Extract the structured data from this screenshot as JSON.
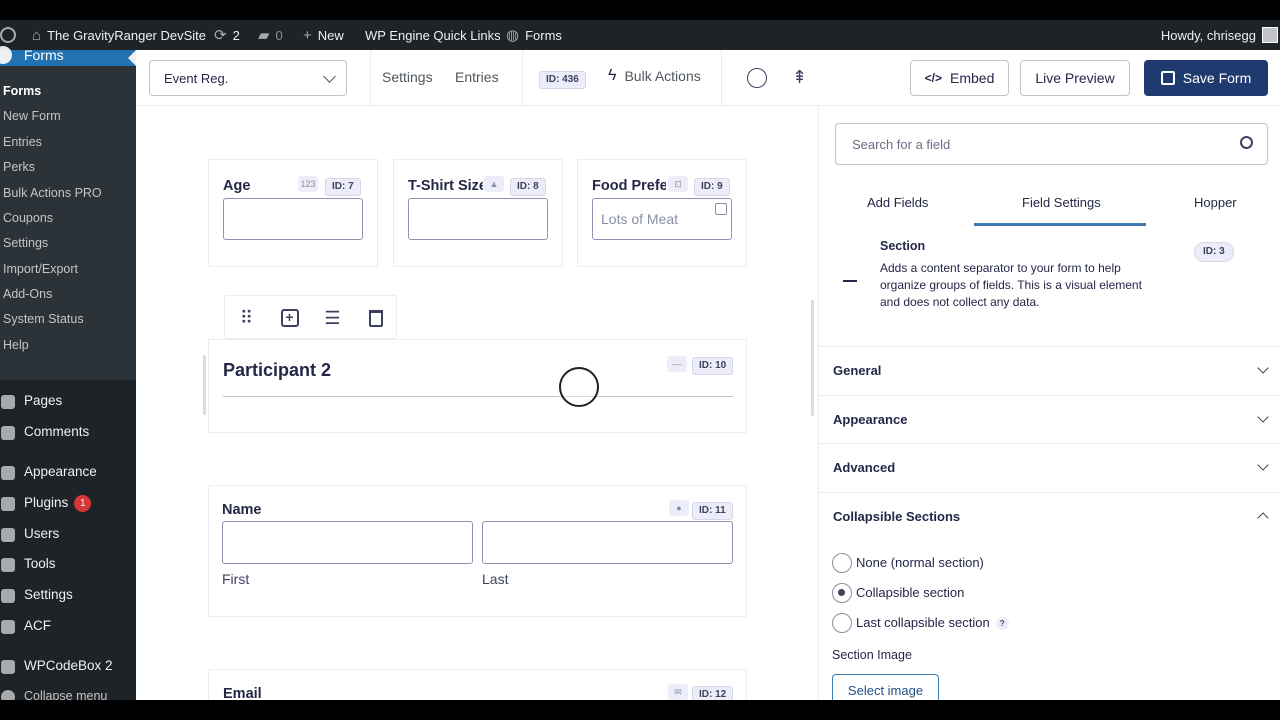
{
  "admin_bar": {
    "site_name": "The GravityRanger DevSite",
    "updates_count": "2",
    "comments_count": "0",
    "new_label": "New",
    "wp_engine": "WP Engine Quick Links",
    "forms": "Forms",
    "howdy": "Howdy, chrisegg"
  },
  "sidebar": {
    "current": "Forms",
    "submenu": [
      "Forms",
      "New Form",
      "Entries",
      "Perks",
      "Bulk Actions PRO",
      "Coupons",
      "Settings",
      "Import/Export",
      "Add-Ons",
      "System Status",
      "Help"
    ],
    "menu": [
      {
        "label": "Pages"
      },
      {
        "label": "Comments"
      },
      {
        "label": "Appearance"
      },
      {
        "label": "Plugins",
        "badge": "1"
      },
      {
        "label": "Users"
      },
      {
        "label": "Tools"
      },
      {
        "label": "Settings"
      },
      {
        "label": "ACF"
      },
      {
        "label": "WPCodeBox 2"
      },
      {
        "label": "Collapse menu"
      }
    ]
  },
  "toolbar": {
    "form_select": "Event Reg.",
    "settings": "Settings",
    "entries": "Entries",
    "form_id": "ID: 436",
    "bulk_actions": "Bulk Actions",
    "embed": "Embed",
    "live_preview": "Live Preview",
    "save_form": "Save Form"
  },
  "canvas": {
    "age": {
      "label": "Age",
      "id": "ID: 7",
      "icon": "123"
    },
    "tshirt": {
      "label": "T-Shirt Size",
      "id": "ID: 8"
    },
    "food": {
      "label": "Food Preference",
      "id": "ID: 9",
      "placeholder": "Lots of Meat"
    },
    "section": {
      "label": "Participant 2",
      "id": "ID: 10"
    },
    "name": {
      "label": "Name",
      "id": "ID: 11",
      "first": "First",
      "last": "Last"
    },
    "email": {
      "label": "Email",
      "id": "ID: 12"
    }
  },
  "panel": {
    "search_placeholder": "Search for a field",
    "tabs": [
      "Add Fields",
      "Field Settings",
      "Hopper"
    ],
    "field_type": "Section",
    "field_id": "ID: 3",
    "field_description": "Adds a content separator to your form to help organize groups of fields. This is a visual element and does not collect any data.",
    "accordions": [
      "General",
      "Appearance",
      "Advanced",
      "Collapsible Sections"
    ],
    "radio_options": [
      {
        "label": "None (normal section)",
        "checked": false
      },
      {
        "label": "Collapsible section",
        "checked": true
      },
      {
        "label": "Last collapsible section",
        "checked": false
      }
    ],
    "help_mark": "?",
    "section_image_label": "Section Image",
    "select_image": "Select image"
  },
  "colors": {
    "admin_bg": "#1d2327",
    "highlight": "#2271b1",
    "save_button": "#1f3a6e",
    "badge_red": "#d63638"
  }
}
